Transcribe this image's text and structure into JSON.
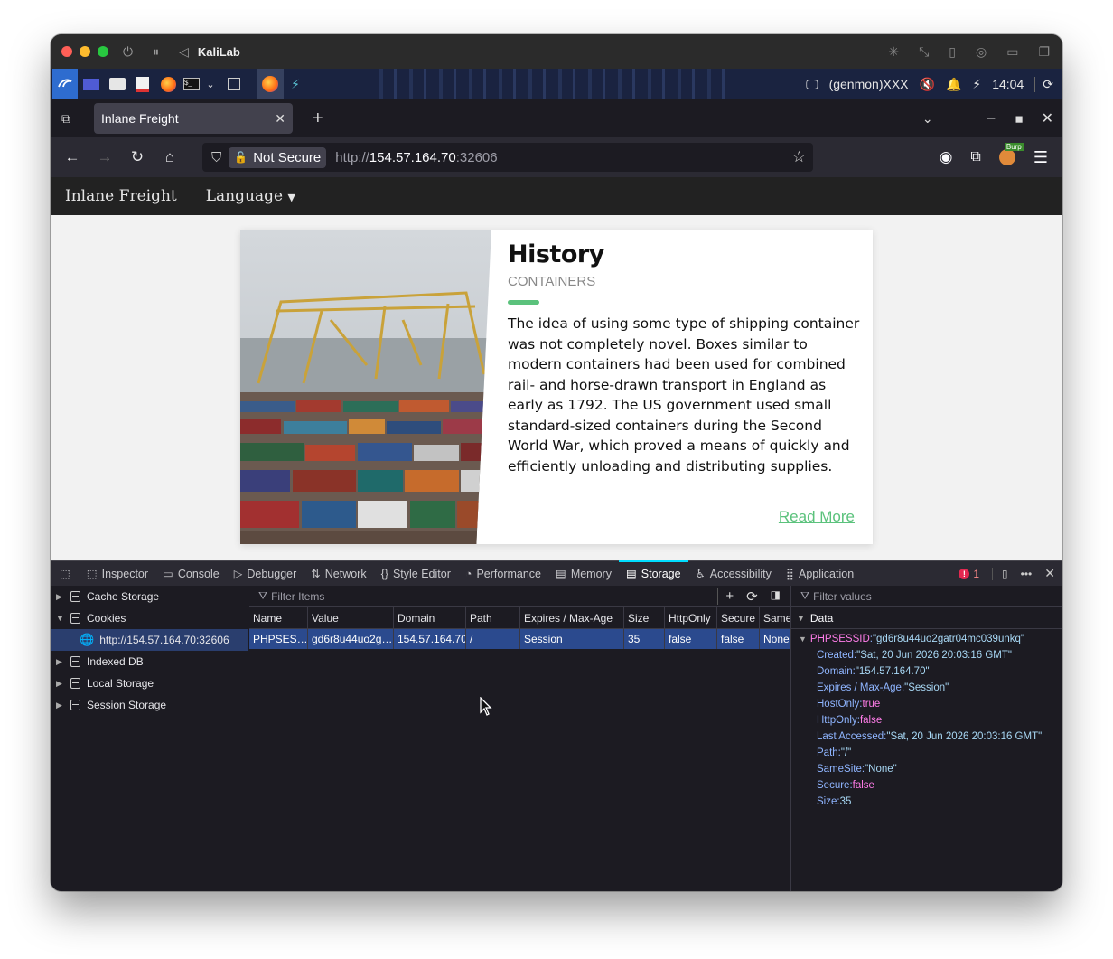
{
  "window": {
    "title": "KaliLab"
  },
  "kali_panel": {
    "user": "(genmon)XXX",
    "time": "14:04"
  },
  "browser": {
    "tab_title": "Inlane Freight",
    "not_secure_label": "Not Secure",
    "url_scheme": "http://",
    "url_host": "154.57.164.70",
    "url_port": ":32606",
    "burp_badge": "Burp"
  },
  "site": {
    "brand": "Inlane Freight",
    "language_menu": "Language",
    "card": {
      "title": "History",
      "subtitle": "CONTAINERS",
      "text": "The idea of using some type of shipping container was not completely novel. Boxes similar to modern containers had been used for combined rail- and horse-drawn transport in England as early as 1792. The US government used small standard-sized containers during the Second World War, which proved a means of quickly and efficiently unloading and distributing supplies.",
      "read_more": "Read More"
    }
  },
  "devtools": {
    "tabs": [
      "Inspector",
      "Console",
      "Debugger",
      "Network",
      "Style Editor",
      "Performance",
      "Memory",
      "Storage",
      "Accessibility",
      "Application"
    ],
    "active_tab": "Storage",
    "error_count": "1",
    "tree": {
      "cache_storage": "Cache Storage",
      "cookies": "Cookies",
      "cookie_host": "http://154.57.164.70:32606",
      "indexed_db": "Indexed DB",
      "local_storage": "Local Storage",
      "session_storage": "Session Storage"
    },
    "filter_items_placeholder": "Filter Items",
    "filter_values_placeholder": "Filter values",
    "columns": [
      "Name",
      "Value",
      "Domain",
      "Path",
      "Expires / Max-Age",
      "Size",
      "HttpOnly",
      "Secure",
      "Same"
    ],
    "row": [
      "PHPSES…",
      "gd6r8u44uo2g…",
      "154.57.164.70",
      "/",
      "Session",
      "35",
      "false",
      "false",
      "None"
    ],
    "data_header": "Data",
    "cookie_name": "PHPSESSID",
    "cookie_value": "\"gd6r8u44uo2gatr04mc039unkq\"",
    "details": [
      {
        "key": "Created",
        "value": "\"Sat, 20 Jun 2026 20:03:16 GMT\"",
        "kind": "s"
      },
      {
        "key": "Domain",
        "value": "\"154.57.164.70\"",
        "kind": "s"
      },
      {
        "key": "Expires / Max-Age",
        "value": "\"Session\"",
        "kind": "s"
      },
      {
        "key": "HostOnly",
        "value": "true",
        "kind": "b"
      },
      {
        "key": "HttpOnly",
        "value": "false",
        "kind": "b"
      },
      {
        "key": "Last Accessed",
        "value": "\"Sat, 20 Jun 2026 20:03:16 GMT\"",
        "kind": "s"
      },
      {
        "key": "Path",
        "value": "\"/\"",
        "kind": "s"
      },
      {
        "key": "SameSite",
        "value": "\"None\"",
        "kind": "s"
      },
      {
        "key": "Secure",
        "value": "false",
        "kind": "b"
      },
      {
        "key": "Size",
        "value": "35",
        "kind": "n"
      }
    ]
  }
}
